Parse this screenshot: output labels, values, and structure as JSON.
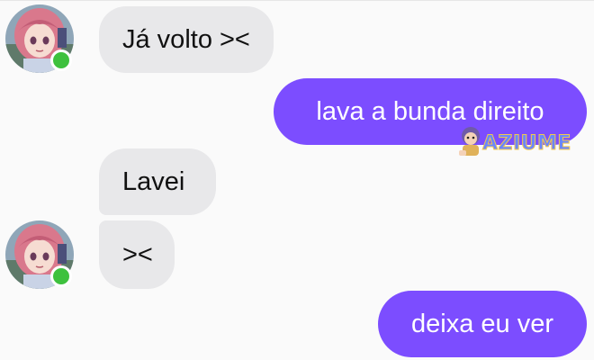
{
  "messages": [
    {
      "side": "in",
      "text": "Já volto ><",
      "has_avatar": true
    },
    {
      "side": "out",
      "text": "lava a bunda direito"
    },
    {
      "side": "in",
      "text": "Lavei",
      "has_avatar": false
    },
    {
      "side": "in",
      "text": "><",
      "has_avatar": true
    },
    {
      "side": "out",
      "text": "deixa eu ver"
    }
  ],
  "watermark": {
    "text": "AZIUME"
  },
  "colors": {
    "background": "#fafafa",
    "incoming_bubble": "#e8e8ea",
    "outgoing_bubble": "#7c4dff",
    "online_status": "#3ec13e"
  },
  "icons": {
    "avatar": "anime-girl-avatar",
    "status": "online-status-icon",
    "watermark_mascot": "mascot-icon"
  }
}
